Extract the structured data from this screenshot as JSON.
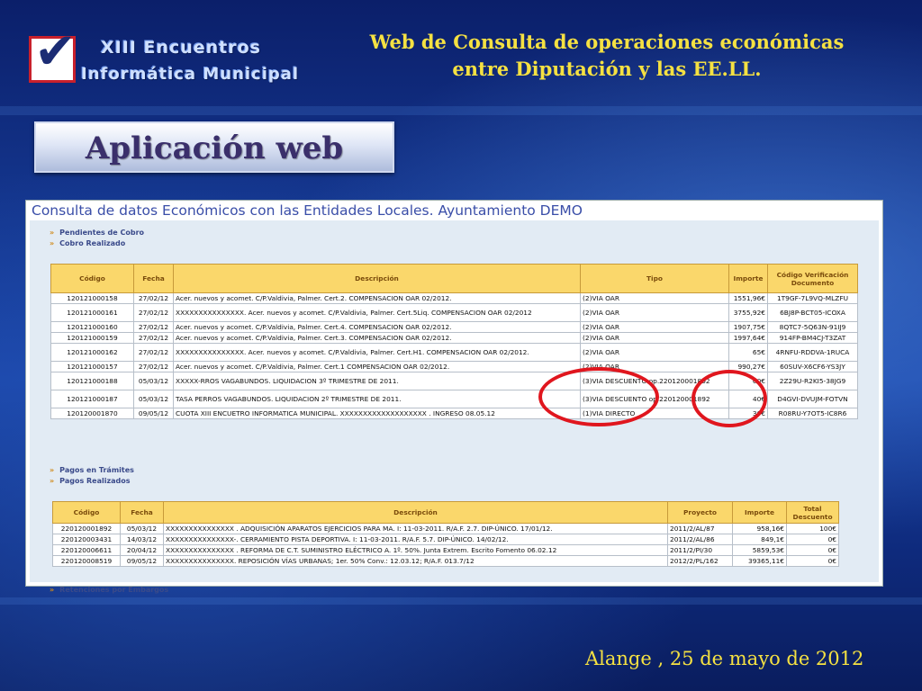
{
  "logo": {
    "line1": "XIII Encuentros",
    "line2": "Informática Municipal",
    "mark": "checkmark-icon"
  },
  "header": {
    "title_line1": "Web  de Consulta de operaciones económicas",
    "title_line2": "entre Diputación y las EE.LL."
  },
  "banner": {
    "label": "Aplicación web"
  },
  "app": {
    "title": "Consulta de datos Económicos con las Entidades Locales. Ayuntamiento DEMO",
    "nav": {
      "pendientes_cobro": "Pendientes de Cobro",
      "cobro_realizado": "Cobro Realizado",
      "pagos_tramites": "Pagos en Trámites",
      "pagos_realizados": "Pagos Realizados",
      "retenciones": "Retenciones por Embargos"
    },
    "cobros_table": {
      "headers": {
        "codigo": "Código",
        "fecha": "Fecha",
        "descripcion": "Descripción",
        "tipo": "Tipo",
        "importe": "Importe",
        "cvd": "Código Verificación Documento"
      },
      "rows": [
        {
          "codigo": "120121000158",
          "fecha": "27/02/12",
          "descripcion": "Acer. nuevos y acomet. C/P.Valdivia, Palmer. Cert.2. COMPENSACION OAR 02/2012.",
          "tipo": "(2)VIA OAR",
          "importe": "1551,96€",
          "cvd": "1T9GF-7L9VQ-MLZFU"
        },
        {
          "codigo": "120121000161",
          "fecha": "27/02/12",
          "descripcion": "XXXXXXXXXXXXXXX. Acer. nuevos y acomet. C/P.Valdivia, Palmer. Cert.5Liq. COMPENSACION OAR 02/2012",
          "tipo": "(2)VIA OAR",
          "importe": "3755,92€",
          "cvd": "6BJ8P-BCT05-ICOXA"
        },
        {
          "codigo": "120121000160",
          "fecha": "27/02/12",
          "descripcion": "Acer. nuevos y acomet. C/P.Valdivia, Palmer. Cert.4. COMPENSACION OAR 02/2012.",
          "tipo": "(2)VIA OAR",
          "importe": "1907,75€",
          "cvd": "8QTC7-5Q63N-91IJ9"
        },
        {
          "codigo": "120121000159",
          "fecha": "27/02/12",
          "descripcion": "Acer. nuevos y acomet. C/P.Valdivia, Palmer. Cert.3. COMPENSACION OAR 02/2012.",
          "tipo": "(2)VIA OAR",
          "importe": "1997,64€",
          "cvd": "914FP-BM4CJ-T3ZAT"
        },
        {
          "codigo": "120121000162",
          "fecha": "27/02/12",
          "descripcion": "XXXXXXXXXXXXXXX. Acer. nuevos y acomet. C/P.Valdivia, Palmer. Cert.H1. COMPENSACION OAR 02/2012.",
          "tipo": "(2)VIA OAR",
          "importe": "65€",
          "cvd": "4RNFU-RDDVA-1RUCA"
        },
        {
          "codigo": "120121000157",
          "fecha": "27/02/12",
          "descripcion": "Acer. nuevos y acomet. C/P.Valdivia, Palmer. Cert.1 COMPENSACION OAR 02/2012.",
          "tipo": "(2)VIA OAR",
          "importe": "990,27€",
          "cvd": "60SUV-X6CF6-YS3JY"
        },
        {
          "codigo": "120121000188",
          "fecha": "05/03/12",
          "descripcion": "XXXXX-RROS VAGABUNDOS. LIQUIDACION 3º TRIMESTRE DE 2011.",
          "tipo": "(3)VIA DESCUENTO op.220120001892",
          "importe": "60€",
          "cvd": "2Z29U-R2KI5-38JG9"
        },
        {
          "codigo": "120121000187",
          "fecha": "05/03/12",
          "descripcion": "TASA PERROS VAGABUNDOS. LIQUIDACION 2º TRIMESTRE DE 2011.",
          "tipo": "(3)VIA DESCUENTO op.220120001892",
          "importe": "40€",
          "cvd": "D4GVI-DVUJM-FOTVN"
        },
        {
          "codigo": "120120001870",
          "fecha": "09/05/12",
          "descripcion": "CUOTA XIII ENCUETRO INFORMATICA MUNICIPAL.    XXXXXXXXXXXXXXXXXXX    . INGRESO 08.05.12",
          "tipo": "(1)VIA DIRECTO",
          "importe": "30€",
          "cvd": "R08RU-Y7OT5-IC8R6"
        }
      ]
    },
    "pagos_table": {
      "headers": {
        "codigo": "Código",
        "fecha": "Fecha",
        "descripcion": "Descripción",
        "proyecto": "Proyecto",
        "importe": "Importe",
        "total": "Total Descuento"
      },
      "rows": [
        {
          "codigo": "220120001892",
          "fecha": "05/03/12",
          "descripcion": "XXXXXXXXXXXXXXX . ADQUISICIÓN APARATOS EJERCICIOS PARA MA. I: 11-03-2011. R/A.F. 2.7. DIP-ÚNICO. 17/01/12.",
          "proyecto": "2011/2/AL/87",
          "importe": "958,16€",
          "total": "100€"
        },
        {
          "codigo": "220120003431",
          "fecha": "14/03/12",
          "descripcion": "XXXXXXXXXXXXXXX-. CERRAMIENTO PISTA DEPORTIVA. I: 11-03-2011. R/A.F. 5.7. DIP-ÚNICO. 14/02/12.",
          "proyecto": "2011/2/AL/86",
          "importe": "849,1€",
          "total": "0€"
        },
        {
          "codigo": "220120006611",
          "fecha": "20/04/12",
          "descripcion": "XXXXXXXXXXXXXXX . REFORMA DE C.T. SUMINISTRO ELÉCTRICO A. 1º. 50%. Junta Extrem. Escrito Fomento 06.02.12",
          "proyecto": "2011/2/PI/30",
          "importe": "5859,53€",
          "total": "0€"
        },
        {
          "codigo": "220120008519",
          "fecha": "09/05/12",
          "descripcion": "XXXXXXXXXXXXXXX. REPOSICIÓN VÍAS URBANAS; 1er. 50% Conv.: 12.03.12; R/A.F. 013.7/12",
          "proyecto": "2012/2/PL/162",
          "importe": "39365,11€",
          "total": "0€"
        }
      ]
    }
  },
  "footer": {
    "text": "Alange , 25 de mayo de 2012"
  },
  "colors": {
    "header_text": "#f5e142",
    "annotation_ring": "#e0161e",
    "table_header": "#fad76b"
  }
}
